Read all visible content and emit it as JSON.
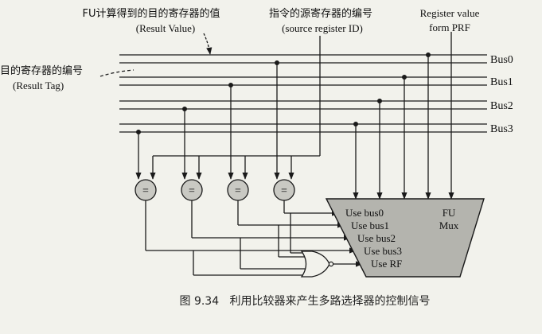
{
  "labels": {
    "result_value_cn": "FU计算得到的目的寄存器的值",
    "result_value_en": "(Result Value)",
    "result_tag_cn": "目的寄存器的编号",
    "result_tag_en": "(Result Tag)",
    "source_reg_cn": "指令的源寄存器的编号",
    "source_reg_en": "(source register ID)",
    "reg_value_line1": "Register value",
    "reg_value_line2": "form PRF"
  },
  "buses": [
    "Bus0",
    "Bus1",
    "Bus2",
    "Bus3"
  ],
  "comparator_symbol": "=",
  "mux": {
    "title_line1": "FU",
    "title_line2": "Mux",
    "inputs": [
      "Use bus0",
      "Use bus1",
      "Use bus2",
      "Use bus3",
      "Use RF"
    ]
  },
  "caption": "图 9.34   利用比较器来产生多路选择器的控制信号",
  "colors": {
    "line": "#1a1a1a",
    "comparator_fill": "#c9c9c3",
    "mux_fill": "#b4b4ae",
    "background": "#f2f2ec"
  }
}
